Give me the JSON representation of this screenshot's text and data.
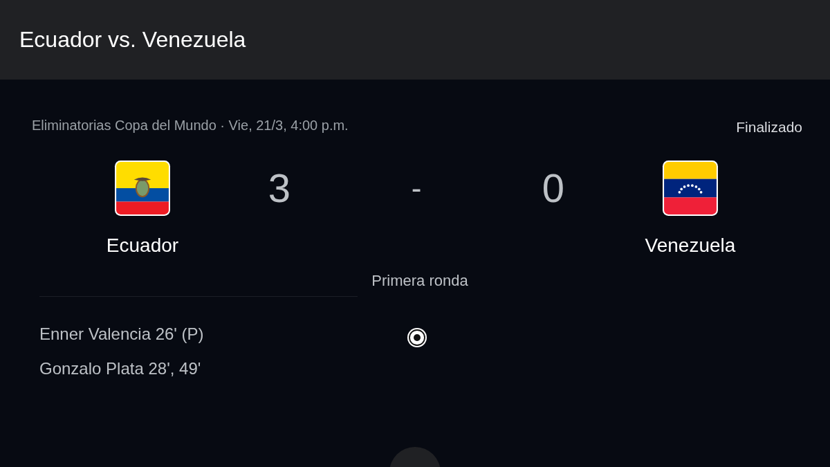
{
  "window": {
    "title": "Ecuador vs. Venezuela"
  },
  "match": {
    "competition": "Eliminatorias Copa del Mundo · Vie, 21/3, 4:00 p.m.",
    "status": "Finalizado",
    "separator": "-",
    "round": "Primera ronda"
  },
  "teams": [
    {
      "name": "Ecuador",
      "score": "3"
    },
    {
      "name": "Venezuela",
      "score": "0"
    }
  ],
  "scorers": [
    "Enner Valencia 26' (P)",
    "Gonzalo Plata 28', 49'"
  ]
}
